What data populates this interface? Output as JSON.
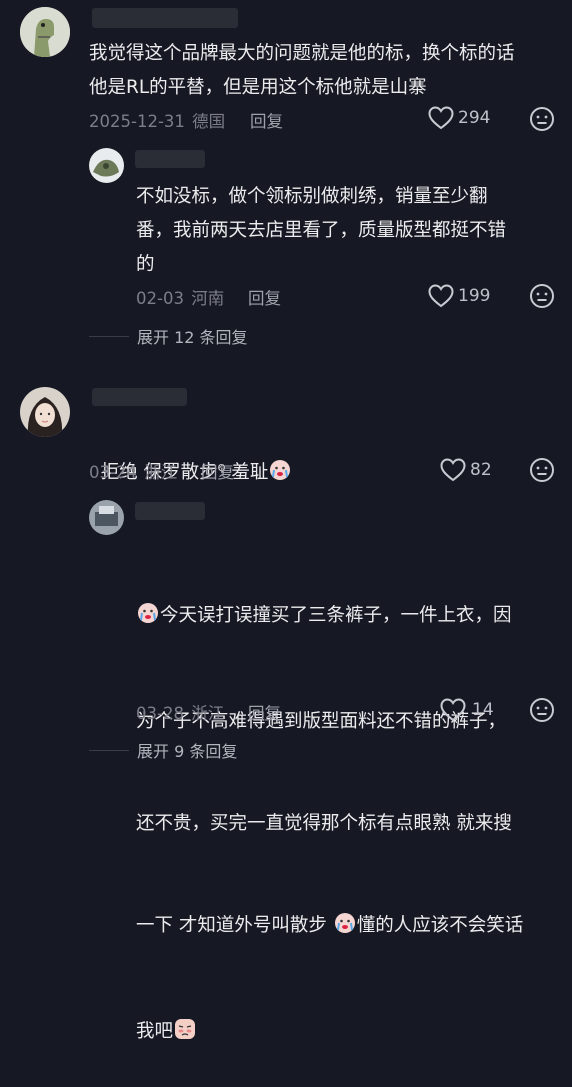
{
  "comments": [
    {
      "text": "我觉得这个品牌最大的问题就是他的标，换个标的话\n他是RL的平替，但是用这个标他就是山寨",
      "date": "2025-12-31",
      "region": "德国",
      "reply_label": "回复",
      "likes": "294"
    },
    {
      "text": "不如没标，做个领标别做刺绣，销量至少翻\n番，我前两天去店里看了，质量版型都挺不错\n的",
      "date": "02-03",
      "region": "河南",
      "reply_label": "回复",
      "likes": "199"
    },
    {
      "text_prefix": "拒绝 保罗散步",
      "text_sup": "Q",
      "text_suffix": " 羞耻",
      "date": "03-24",
      "region": "浙江",
      "reply_label": "回复",
      "likes": "82"
    },
    {
      "line1": "今天误打误撞买了三条裤子，一件上衣，因",
      "line2": "为个子不高难得遇到版型面料还不错的裤子，",
      "line3": "还不贵，买完一直觉得那个标有点眼熟 就来搜",
      "line4a": "一下 才知道外号叫散步 ",
      "line4b": "懂的人应该不会笑话",
      "line5": "我吧",
      "date": "03-28",
      "region": "浙江",
      "reply_label": "回复",
      "likes": "14"
    }
  ],
  "expand1": "展开 12 条回复",
  "expand2": "展开 9 条回复",
  "icons": {
    "like": "heart-outline-icon",
    "dislike": "meh-face-icon",
    "emoji_cry": "crying-face-emoji",
    "emoji_shy": "shy-face-emoji"
  }
}
